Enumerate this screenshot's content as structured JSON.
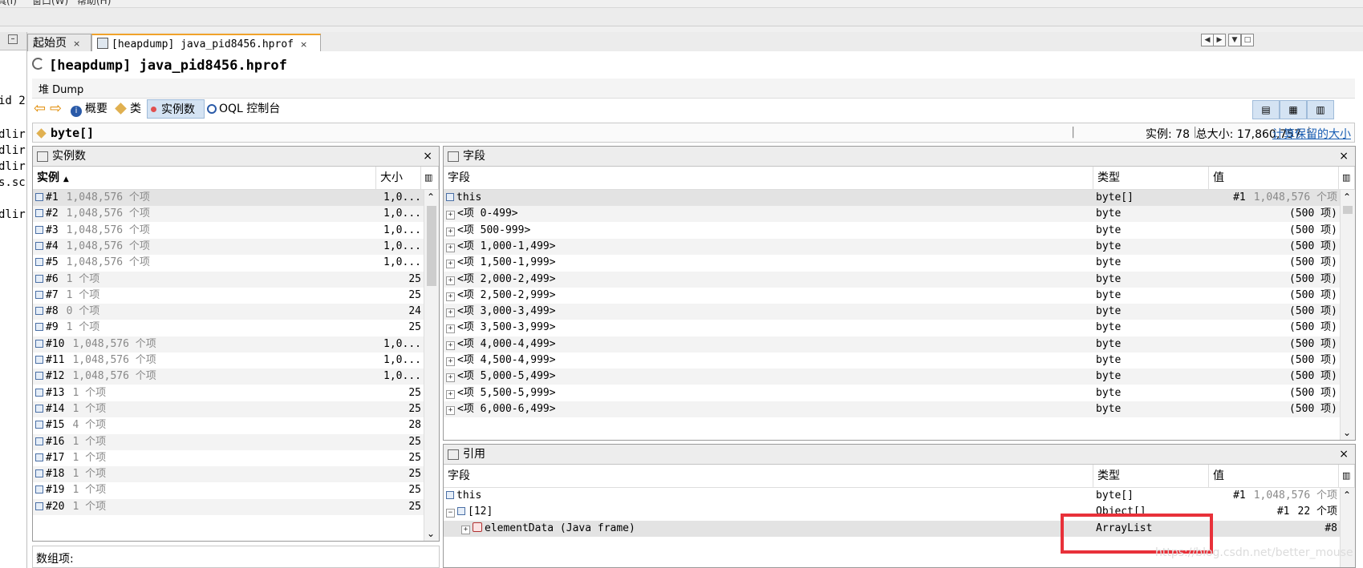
{
  "menubar": {
    "items": [
      "具(I)",
      "窗口(W)",
      "帮助(H)"
    ]
  },
  "left_pane": {
    "lines": [
      "id 2",
      "",
      "dlir",
      "dlir",
      "dlir",
      "s.sc",
      "",
      "dlir"
    ]
  },
  "tabs": [
    {
      "label": "起始页",
      "close": "×"
    },
    {
      "label": "[heapdump] java_pid8456.hprof",
      "close": "×"
    }
  ],
  "doc_title": "[heapdump] java_pid8456.hprof",
  "heap_tab": "堆 Dump",
  "view_buttons": {
    "summary": "概要",
    "classes": "类",
    "instances": "实例数",
    "oql": "OQL 控制台"
  },
  "class_bar": {
    "class_name": "byte[]",
    "instances_label": "实例: 78",
    "total_size_label": "总大小: 17,860,757",
    "sep": "|",
    "retained_link": "计算保留的大小"
  },
  "instances_panel": {
    "title": "实例数",
    "close": "×",
    "col_instance": "实例",
    "col_size": "大小",
    "rows": [
      {
        "id": "#1",
        "items": "1,048,576 个项",
        "size": "1,0..."
      },
      {
        "id": "#2",
        "items": "1,048,576 个项",
        "size": "1,0..."
      },
      {
        "id": "#3",
        "items": "1,048,576 个项",
        "size": "1,0..."
      },
      {
        "id": "#4",
        "items": "1,048,576 个项",
        "size": "1,0..."
      },
      {
        "id": "#5",
        "items": "1,048,576 个项",
        "size": "1,0..."
      },
      {
        "id": "#6",
        "items": "1 个项",
        "size": "25"
      },
      {
        "id": "#7",
        "items": "1 个项",
        "size": "25"
      },
      {
        "id": "#8",
        "items": "0 个项",
        "size": "24"
      },
      {
        "id": "#9",
        "items": "1 个项",
        "size": "25"
      },
      {
        "id": "#10",
        "items": "1,048,576 个项",
        "size": "1,0..."
      },
      {
        "id": "#11",
        "items": "1,048,576 个项",
        "size": "1,0..."
      },
      {
        "id": "#12",
        "items": "1,048,576 个项",
        "size": "1,0..."
      },
      {
        "id": "#13",
        "items": "1 个项",
        "size": "25"
      },
      {
        "id": "#14",
        "items": "1 个项",
        "size": "25"
      },
      {
        "id": "#15",
        "items": "4 个项",
        "size": "28"
      },
      {
        "id": "#16",
        "items": "1 个项",
        "size": "25"
      },
      {
        "id": "#17",
        "items": "1 个项",
        "size": "25"
      },
      {
        "id": "#18",
        "items": "1 个项",
        "size": "25"
      },
      {
        "id": "#19",
        "items": "1 个项",
        "size": "25"
      },
      {
        "id": "#20",
        "items": "1 个项",
        "size": "25"
      }
    ],
    "array_items_label": "数组项:"
  },
  "fields_panel": {
    "title": "字段",
    "close": "×",
    "col_field": "字段",
    "col_type": "类型",
    "col_value": "值",
    "rows": [
      {
        "field": "this",
        "type": "byte[]",
        "value_id": "#1",
        "value": "1,048,576 个项",
        "kind": "this"
      },
      {
        "field": "<项 0-499>",
        "type": "byte",
        "value": "(500 项)"
      },
      {
        "field": "<项 500-999>",
        "type": "byte",
        "value": "(500 项)"
      },
      {
        "field": "<项 1,000-1,499>",
        "type": "byte",
        "value": "(500 项)"
      },
      {
        "field": "<项 1,500-1,999>",
        "type": "byte",
        "value": "(500 项)"
      },
      {
        "field": "<项 2,000-2,499>",
        "type": "byte",
        "value": "(500 项)"
      },
      {
        "field": "<项 2,500-2,999>",
        "type": "byte",
        "value": "(500 项)"
      },
      {
        "field": "<项 3,000-3,499>",
        "type": "byte",
        "value": "(500 项)"
      },
      {
        "field": "<项 3,500-3,999>",
        "type": "byte",
        "value": "(500 项)"
      },
      {
        "field": "<项 4,000-4,499>",
        "type": "byte",
        "value": "(500 项)"
      },
      {
        "field": "<项 4,500-4,999>",
        "type": "byte",
        "value": "(500 项)"
      },
      {
        "field": "<项 5,000-5,499>",
        "type": "byte",
        "value": "(500 项)"
      },
      {
        "field": "<项 5,500-5,999>",
        "type": "byte",
        "value": "(500 项)"
      },
      {
        "field": "<项 6,000-6,499>",
        "type": "byte",
        "value": "(500 项)"
      }
    ]
  },
  "refs_panel": {
    "title": "引用",
    "close": "×",
    "col_field": "字段",
    "col_type": "类型",
    "col_value": "值",
    "rows": [
      {
        "field": "this",
        "type": "byte[]",
        "value_id": "#1",
        "value": "1,048,576 个项"
      },
      {
        "field": "[12]",
        "type": "Object[]",
        "value_id": "#1",
        "value": "22 个项"
      },
      {
        "field": "elementData (Java frame)",
        "type": "ArrayList",
        "value_id": "",
        "value": "#8"
      }
    ]
  },
  "watermark": "https://blog.csdn.net/better_mouse",
  "colors": {
    "highlight_box": "#e8313a",
    "active_tab_accent": "#f0a22a",
    "link": "#1a5fb4"
  }
}
